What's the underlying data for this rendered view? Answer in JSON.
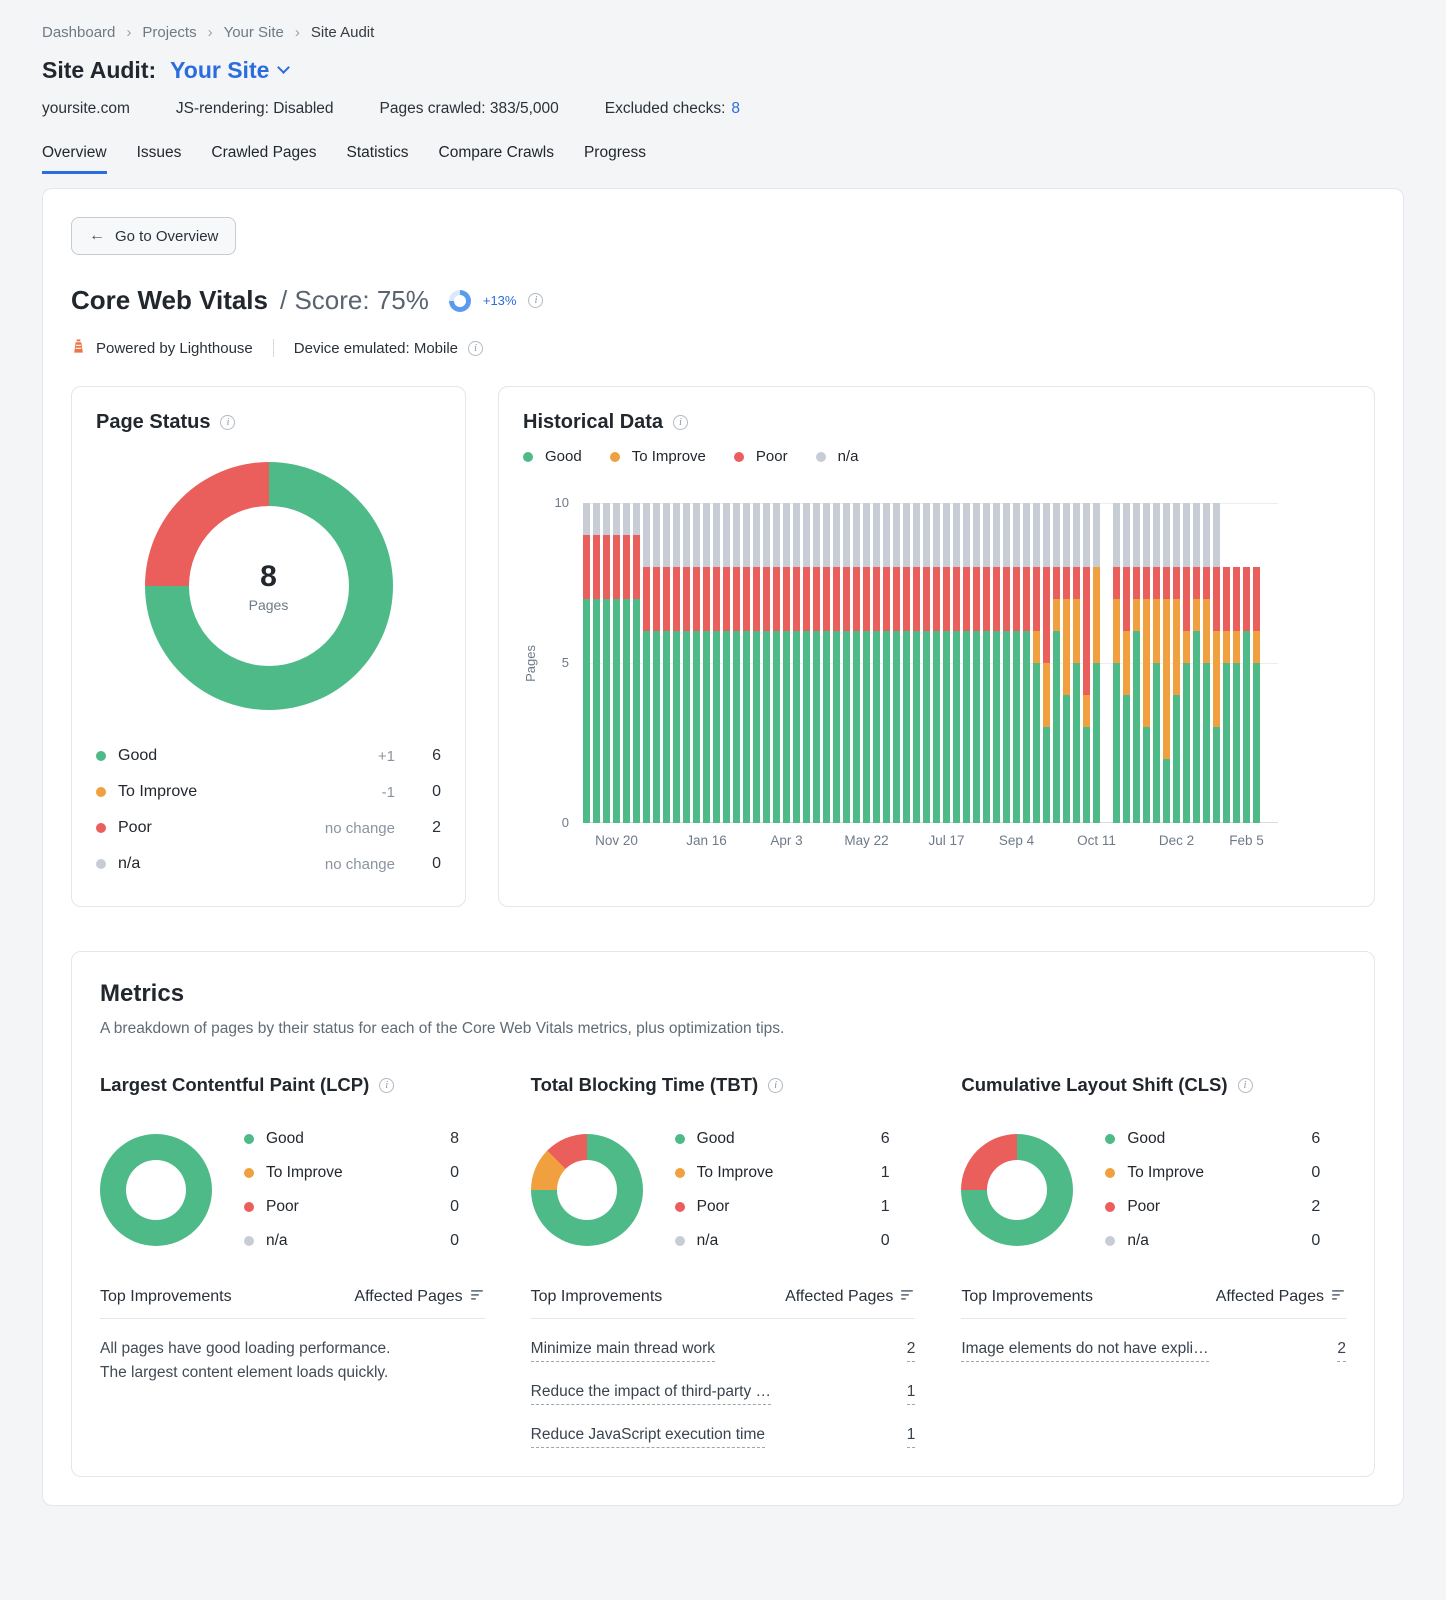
{
  "colors": {
    "good": "#4dba87",
    "to_improve": "#f0a03f",
    "poor": "#ea5e5c",
    "na": "#c8cdd5",
    "link_blue": "#2b6cdf",
    "score_blue": "#5b9bed",
    "track": "#dbe7fa"
  },
  "icons": {
    "info": "i",
    "back_arrow": "←",
    "breadcrumb_separator": "›"
  },
  "breadcrumb": [
    "Dashboard",
    "Projects",
    "Your Site",
    "Site Audit"
  ],
  "header": {
    "title": "Site Audit:",
    "site": "Your Site",
    "meta": {
      "domain": "yoursite.com",
      "js_rendering": "JS-rendering: Disabled",
      "pages_crawled": "Pages crawled: 383/5,000",
      "excluded_checks_label": "Excluded checks:",
      "excluded_checks_value": "8"
    }
  },
  "tabs": [
    {
      "label": "Overview",
      "active": true
    },
    {
      "label": "Issues",
      "active": false
    },
    {
      "label": "Crawled Pages",
      "active": false
    },
    {
      "label": "Statistics",
      "active": false
    },
    {
      "label": "Compare Crawls",
      "active": false
    },
    {
      "label": "Progress",
      "active": false
    }
  ],
  "overview": {
    "back_button": "Go to Overview",
    "title": "Core Web Vitals",
    "score_label": "/ Score: 75%",
    "score_percent": 75,
    "score_delta": "+13%",
    "powered_by": "Powered by Lighthouse",
    "device": "Device emulated: Mobile"
  },
  "page_status": {
    "title": "Page Status",
    "center_value": "8",
    "center_label": "Pages",
    "legend": [
      {
        "label": "Good",
        "color": "good",
        "change": "+1",
        "value": "6"
      },
      {
        "label": "To Improve",
        "color": "to_improve",
        "change": "-1",
        "value": "0"
      },
      {
        "label": "Poor",
        "color": "poor",
        "change": "no change",
        "value": "2"
      },
      {
        "label": "n/a",
        "color": "na",
        "change": "no change",
        "value": "0"
      }
    ]
  },
  "historical": {
    "title": "Historical Data",
    "legend": [
      {
        "label": "Good",
        "color": "good"
      },
      {
        "label": "To Improve",
        "color": "to_improve"
      },
      {
        "label": "Poor",
        "color": "poor"
      },
      {
        "label": "n/a",
        "color": "na"
      }
    ],
    "y_label": "Pages",
    "y_ticks": [
      10,
      5,
      0
    ]
  },
  "chart_data": [
    {
      "type": "pie",
      "title": "Page Status",
      "center_total": 8,
      "slices": [
        {
          "label": "Good",
          "value": 6,
          "color": "good"
        },
        {
          "label": "To Improve",
          "value": 0,
          "color": "to_improve"
        },
        {
          "label": "Poor",
          "value": 2,
          "color": "poor"
        },
        {
          "label": "n/a",
          "value": 0,
          "color": "na"
        }
      ]
    },
    {
      "type": "bar",
      "stacked": true,
      "title": "Historical Data",
      "ylabel": "Pages",
      "ylim": [
        0,
        10
      ],
      "legend_position": "top",
      "series_keys": [
        "good",
        "to_improve",
        "poor",
        "na"
      ],
      "bars": [
        [
          7,
          0,
          2,
          1
        ],
        [
          7,
          0,
          2,
          1
        ],
        [
          7,
          0,
          2,
          1
        ],
        [
          7,
          0,
          2,
          1
        ],
        [
          7,
          0,
          2,
          1
        ],
        [
          7,
          0,
          2,
          1
        ],
        [
          6,
          0,
          2,
          2
        ],
        [
          6,
          0,
          2,
          2
        ],
        [
          6,
          0,
          2,
          2
        ],
        [
          6,
          0,
          2,
          2
        ],
        [
          6,
          0,
          2,
          2
        ],
        [
          6,
          0,
          2,
          2
        ],
        [
          6,
          0,
          2,
          2
        ],
        [
          6,
          0,
          2,
          2
        ],
        [
          6,
          0,
          2,
          2
        ],
        [
          6,
          0,
          2,
          2
        ],
        [
          6,
          0,
          2,
          2
        ],
        [
          6,
          0,
          2,
          2
        ],
        [
          6,
          0,
          2,
          2
        ],
        [
          6,
          0,
          2,
          2
        ],
        [
          6,
          0,
          2,
          2
        ],
        [
          6,
          0,
          2,
          2
        ],
        [
          6,
          0,
          2,
          2
        ],
        [
          6,
          0,
          2,
          2
        ],
        [
          6,
          0,
          2,
          2
        ],
        [
          6,
          0,
          2,
          2
        ],
        [
          6,
          0,
          2,
          2
        ],
        [
          6,
          0,
          2,
          2
        ],
        [
          6,
          0,
          2,
          2
        ],
        [
          6,
          0,
          2,
          2
        ],
        [
          6,
          0,
          2,
          2
        ],
        [
          6,
          0,
          2,
          2
        ],
        [
          6,
          0,
          2,
          2
        ],
        [
          6,
          0,
          2,
          2
        ],
        [
          6,
          0,
          2,
          2
        ],
        [
          6,
          0,
          2,
          2
        ],
        [
          6,
          0,
          2,
          2
        ],
        [
          6,
          0,
          2,
          2
        ],
        [
          6,
          0,
          2,
          2
        ],
        [
          6,
          0,
          2,
          2
        ],
        [
          6,
          0,
          2,
          2
        ],
        [
          6,
          0,
          2,
          2
        ],
        [
          6,
          0,
          2,
          2
        ],
        [
          6,
          0,
          2,
          2
        ],
        [
          6,
          0,
          2,
          2
        ],
        [
          5,
          1,
          2,
          2
        ],
        [
          3,
          2,
          3,
          2
        ],
        [
          6,
          1,
          1,
          2
        ],
        [
          4,
          3,
          1,
          2
        ],
        [
          5,
          2,
          1,
          2
        ],
        [
          3,
          1,
          4,
          2
        ],
        [
          5,
          3,
          0,
          2
        ],
        null,
        [
          5,
          2,
          1,
          2
        ],
        [
          4,
          2,
          2,
          2
        ],
        [
          6,
          1,
          1,
          2
        ],
        [
          3,
          4,
          1,
          2
        ],
        [
          5,
          2,
          1,
          2
        ],
        [
          2,
          5,
          1,
          2
        ],
        [
          4,
          3,
          1,
          2
        ],
        [
          5,
          1,
          2,
          2
        ],
        [
          6,
          1,
          1,
          2
        ],
        [
          5,
          2,
          1,
          2
        ],
        [
          3,
          3,
          2,
          2
        ],
        [
          5,
          1,
          2,
          0
        ],
        [
          5,
          1,
          2,
          0
        ],
        [
          6,
          0,
          2,
          0
        ],
        [
          5,
          1,
          2,
          0
        ]
      ],
      "x_ticks": [
        {
          "index": 3,
          "label": "Nov 20"
        },
        {
          "index": 12,
          "label": "Jan 16"
        },
        {
          "index": 20,
          "label": "Apr 3"
        },
        {
          "index": 28,
          "label": "May 22"
        },
        {
          "index": 36,
          "label": "Jul 17"
        },
        {
          "index": 43,
          "label": "Sep 4"
        },
        {
          "index": 51,
          "label": "Oct 11"
        },
        {
          "index": 59,
          "label": "Dec 2"
        },
        {
          "index": 66,
          "label": "Feb 5"
        }
      ]
    },
    {
      "type": "pie",
      "title": "Largest Contentful Paint (LCP)",
      "slices": [
        {
          "label": "Good",
          "value": 8,
          "color": "good"
        },
        {
          "label": "To Improve",
          "value": 0,
          "color": "to_improve"
        },
        {
          "label": "Poor",
          "value": 0,
          "color": "poor"
        },
        {
          "label": "n/a",
          "value": 0,
          "color": "na"
        }
      ]
    },
    {
      "type": "pie",
      "title": "Total Blocking Time (TBT)",
      "slices": [
        {
          "label": "Good",
          "value": 6,
          "color": "good"
        },
        {
          "label": "To Improve",
          "value": 1,
          "color": "to_improve"
        },
        {
          "label": "Poor",
          "value": 1,
          "color": "poor"
        },
        {
          "label": "n/a",
          "value": 0,
          "color": "na"
        }
      ]
    },
    {
      "type": "pie",
      "title": "Cumulative Layout Shift (CLS)",
      "slices": [
        {
          "label": "Good",
          "value": 6,
          "color": "good"
        },
        {
          "label": "To Improve",
          "value": 0,
          "color": "to_improve"
        },
        {
          "label": "Poor",
          "value": 2,
          "color": "poor"
        },
        {
          "label": "n/a",
          "value": 0,
          "color": "na"
        }
      ]
    }
  ],
  "metrics": {
    "title": "Metrics",
    "subtitle": "A breakdown of pages by their status for each of the Core Web Vitals metrics, plus optimization tips.",
    "col_header_left": "Top Improvements",
    "col_header_right": "Affected Pages",
    "columns": [
      {
        "key": "lcp",
        "title": "Largest Contentful Paint (LCP)",
        "legend": [
          {
            "label": "Good",
            "color": "good",
            "value": "8"
          },
          {
            "label": "To Improve",
            "color": "to_improve",
            "value": "0"
          },
          {
            "label": "Poor",
            "color": "poor",
            "value": "0"
          },
          {
            "label": "n/a",
            "color": "na",
            "value": "0"
          }
        ],
        "note": "All pages have good loading performance. The largest content element loads quickly.",
        "improvements": []
      },
      {
        "key": "tbt",
        "title": "Total Blocking Time (TBT)",
        "legend": [
          {
            "label": "Good",
            "color": "good",
            "value": "6"
          },
          {
            "label": "To Improve",
            "color": "to_improve",
            "value": "1"
          },
          {
            "label": "Poor",
            "color": "poor",
            "value": "1"
          },
          {
            "label": "n/a",
            "color": "na",
            "value": "0"
          }
        ],
        "note": "",
        "improvements": [
          {
            "text": "Minimize main thread work",
            "count": "2"
          },
          {
            "text": "Reduce the impact of third-party …",
            "count": "1"
          },
          {
            "text": "Reduce JavaScript execution time",
            "count": "1"
          }
        ]
      },
      {
        "key": "cls",
        "title": "Cumulative Layout Shift (CLS)",
        "legend": [
          {
            "label": "Good",
            "color": "good",
            "value": "6"
          },
          {
            "label": "To Improve",
            "color": "to_improve",
            "value": "0"
          },
          {
            "label": "Poor",
            "color": "poor",
            "value": "2"
          },
          {
            "label": "n/a",
            "color": "na",
            "value": "0"
          }
        ],
        "note": "",
        "improvements": [
          {
            "text": "Image elements do not have expli…",
            "count": "2"
          }
        ]
      }
    ]
  }
}
